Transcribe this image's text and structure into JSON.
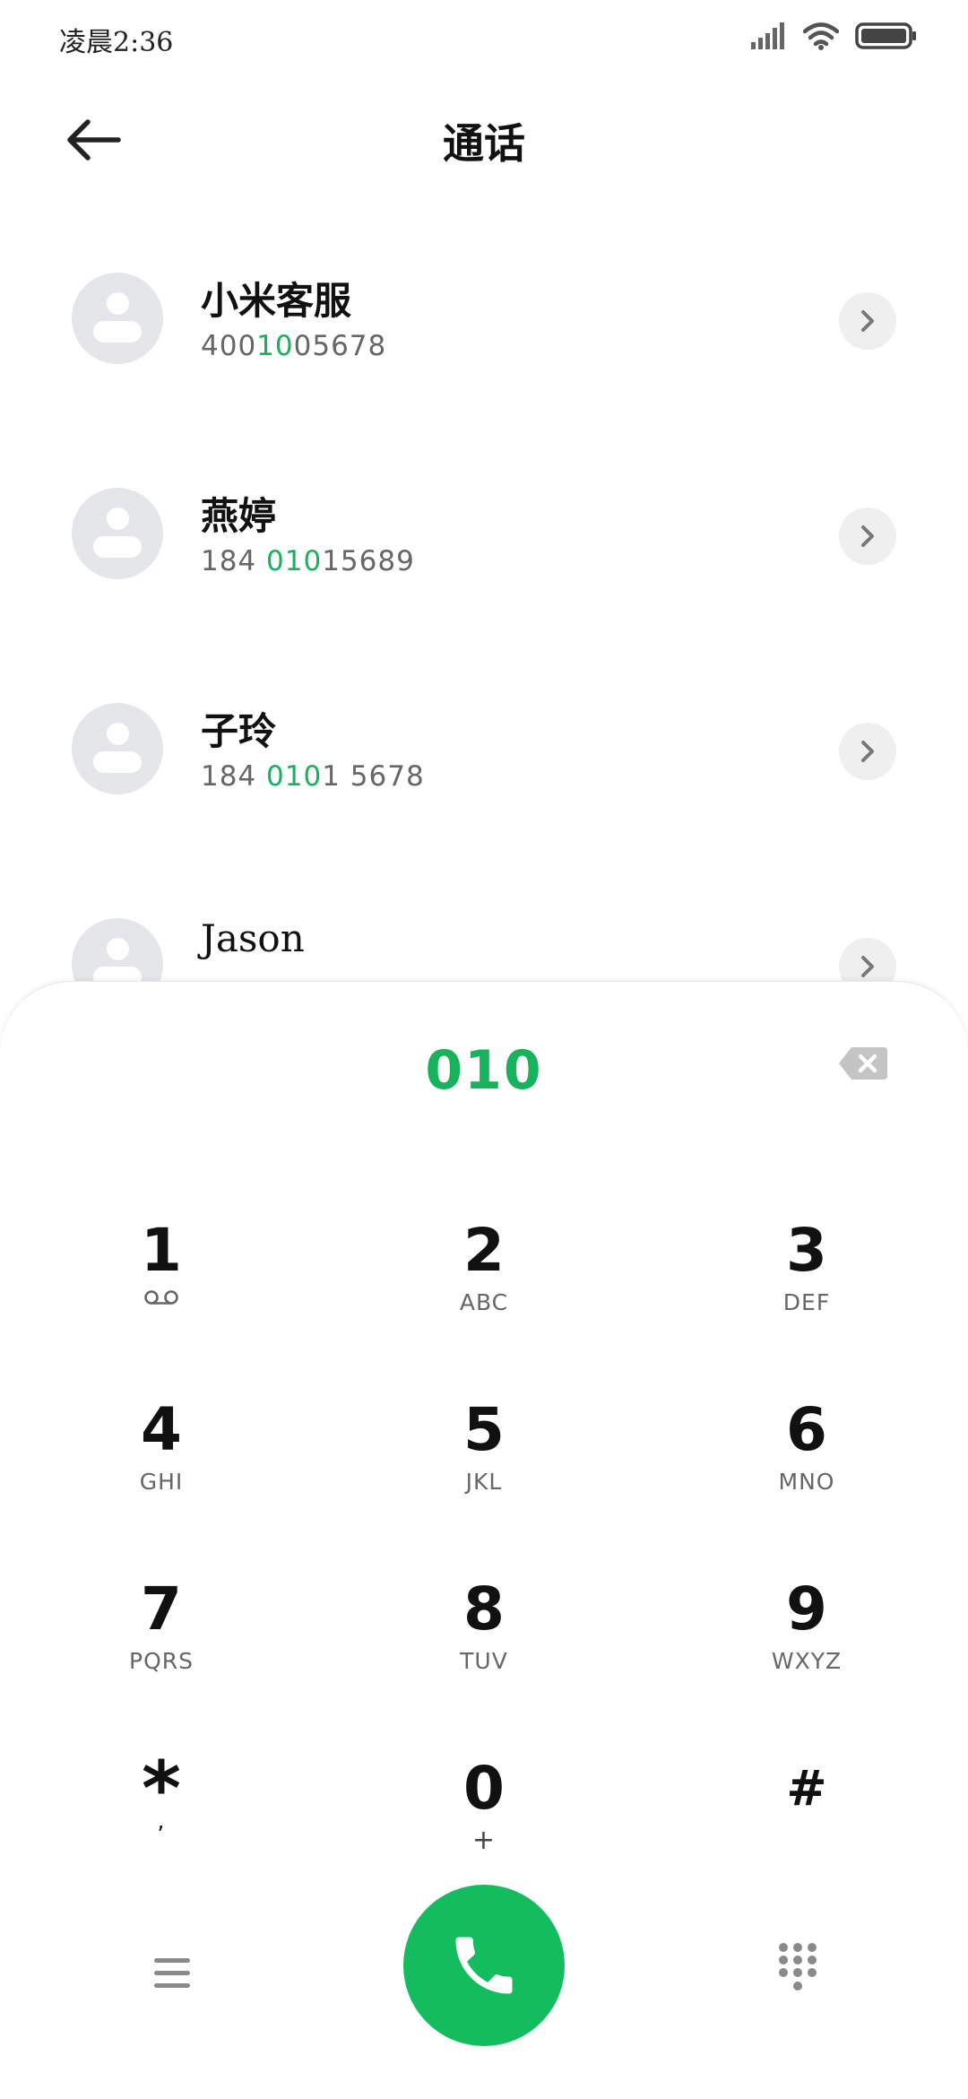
{
  "status_bar": {
    "time": "凌晨2:36",
    "signal_icon": "signal-icon",
    "wifi_icon": "wifi-icon",
    "battery_icon": "battery-icon"
  },
  "header": {
    "title": "通话",
    "back_icon": "arrow-left-icon"
  },
  "contacts": [
    {
      "name": "小米客服",
      "number_parts": [
        "400",
        "10",
        "05678"
      ]
    },
    {
      "name": "燕婷",
      "number_parts": [
        "184 ",
        "010",
        "15689"
      ]
    },
    {
      "name": "子玲",
      "number_parts": [
        "184 ",
        "010",
        "1 5678"
      ]
    },
    {
      "name": "Jason",
      "number_parts": [
        "",
        "",
        ""
      ]
    }
  ],
  "dialpad": {
    "input": "010",
    "backspace_icon": "backspace-icon",
    "keys": [
      {
        "digit": "1",
        "letters": "",
        "icon": "voicemail-icon"
      },
      {
        "digit": "2",
        "letters": "ABC"
      },
      {
        "digit": "3",
        "letters": "DEF"
      },
      {
        "digit": "4",
        "letters": "GHI"
      },
      {
        "digit": "5",
        "letters": "JKL"
      },
      {
        "digit": "6",
        "letters": "MNO"
      },
      {
        "digit": "7",
        "letters": "PQRS"
      },
      {
        "digit": "8",
        "letters": "TUV"
      },
      {
        "digit": "9",
        "letters": "WXYZ"
      },
      {
        "digit": "*",
        "letters": ","
      },
      {
        "digit": "0",
        "letters": "+"
      },
      {
        "digit": "#",
        "letters": ""
      }
    ]
  },
  "actions": {
    "menu_icon": "menu-icon",
    "call_icon": "phone-icon",
    "keypad_icon": "dialpad-icon"
  },
  "colors": {
    "accent": "#13bd5e",
    "highlight": "#16b35c"
  }
}
